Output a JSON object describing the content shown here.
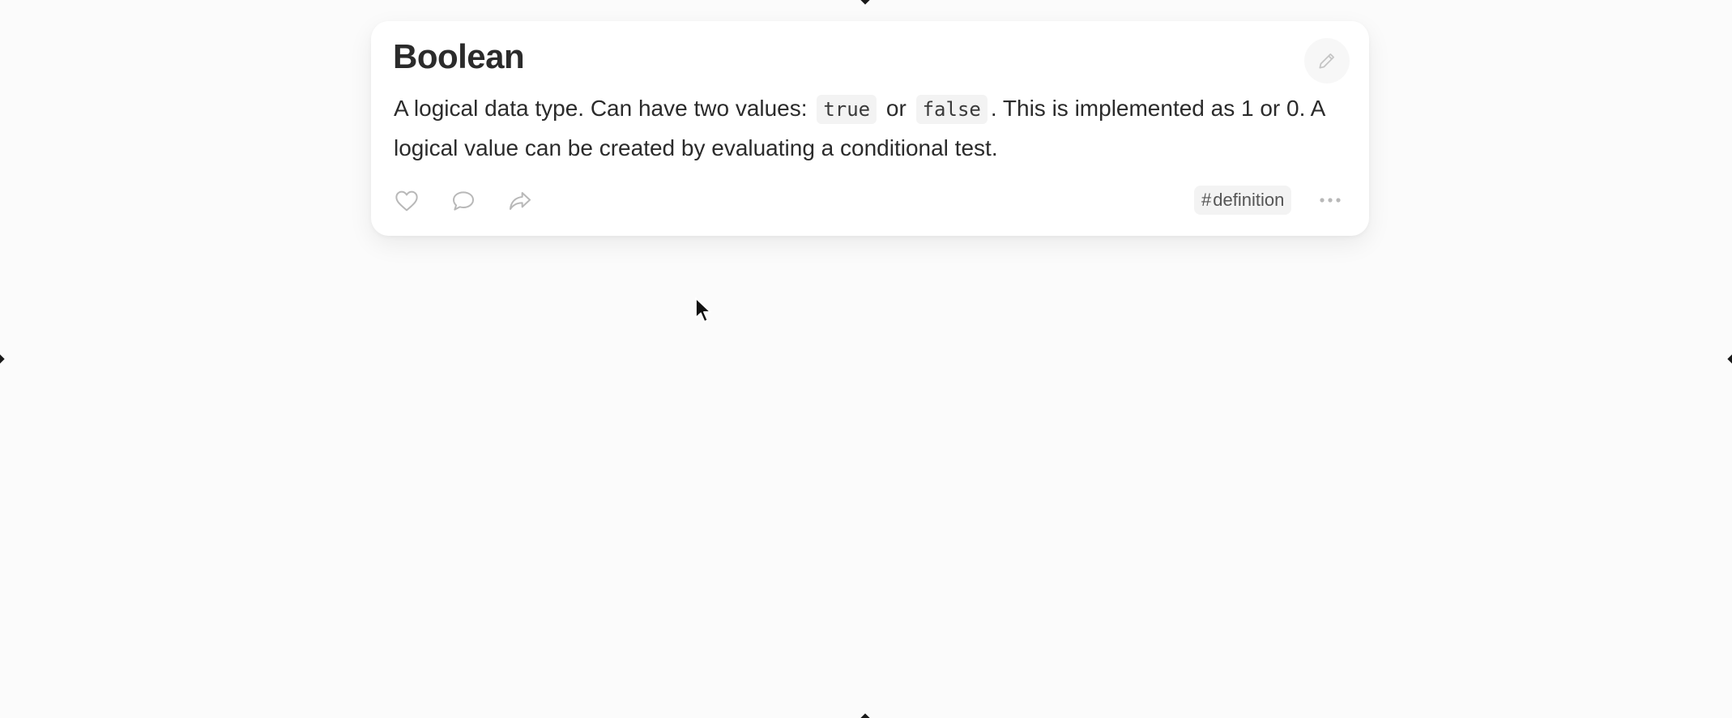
{
  "card": {
    "title": "Boolean",
    "body": {
      "part1": "A logical data type. Can have two values: ",
      "code1": "true",
      "part2": " or ",
      "code2": "false",
      "part3": ". This is implemented as 1 or 0. A logical value can be created by evaluating a conditional test."
    },
    "tag": {
      "hash": "#",
      "label": "definition"
    },
    "icons": {
      "edit": "pencil-icon",
      "like": "heart-icon",
      "comment": "comment-icon",
      "share": "share-icon",
      "more": "more-dots-icon"
    }
  },
  "colors": {
    "background": "#fbfbfb",
    "card": "#ffffff",
    "text": "#2b2b2b",
    "icon": "#b8b8b8"
  }
}
